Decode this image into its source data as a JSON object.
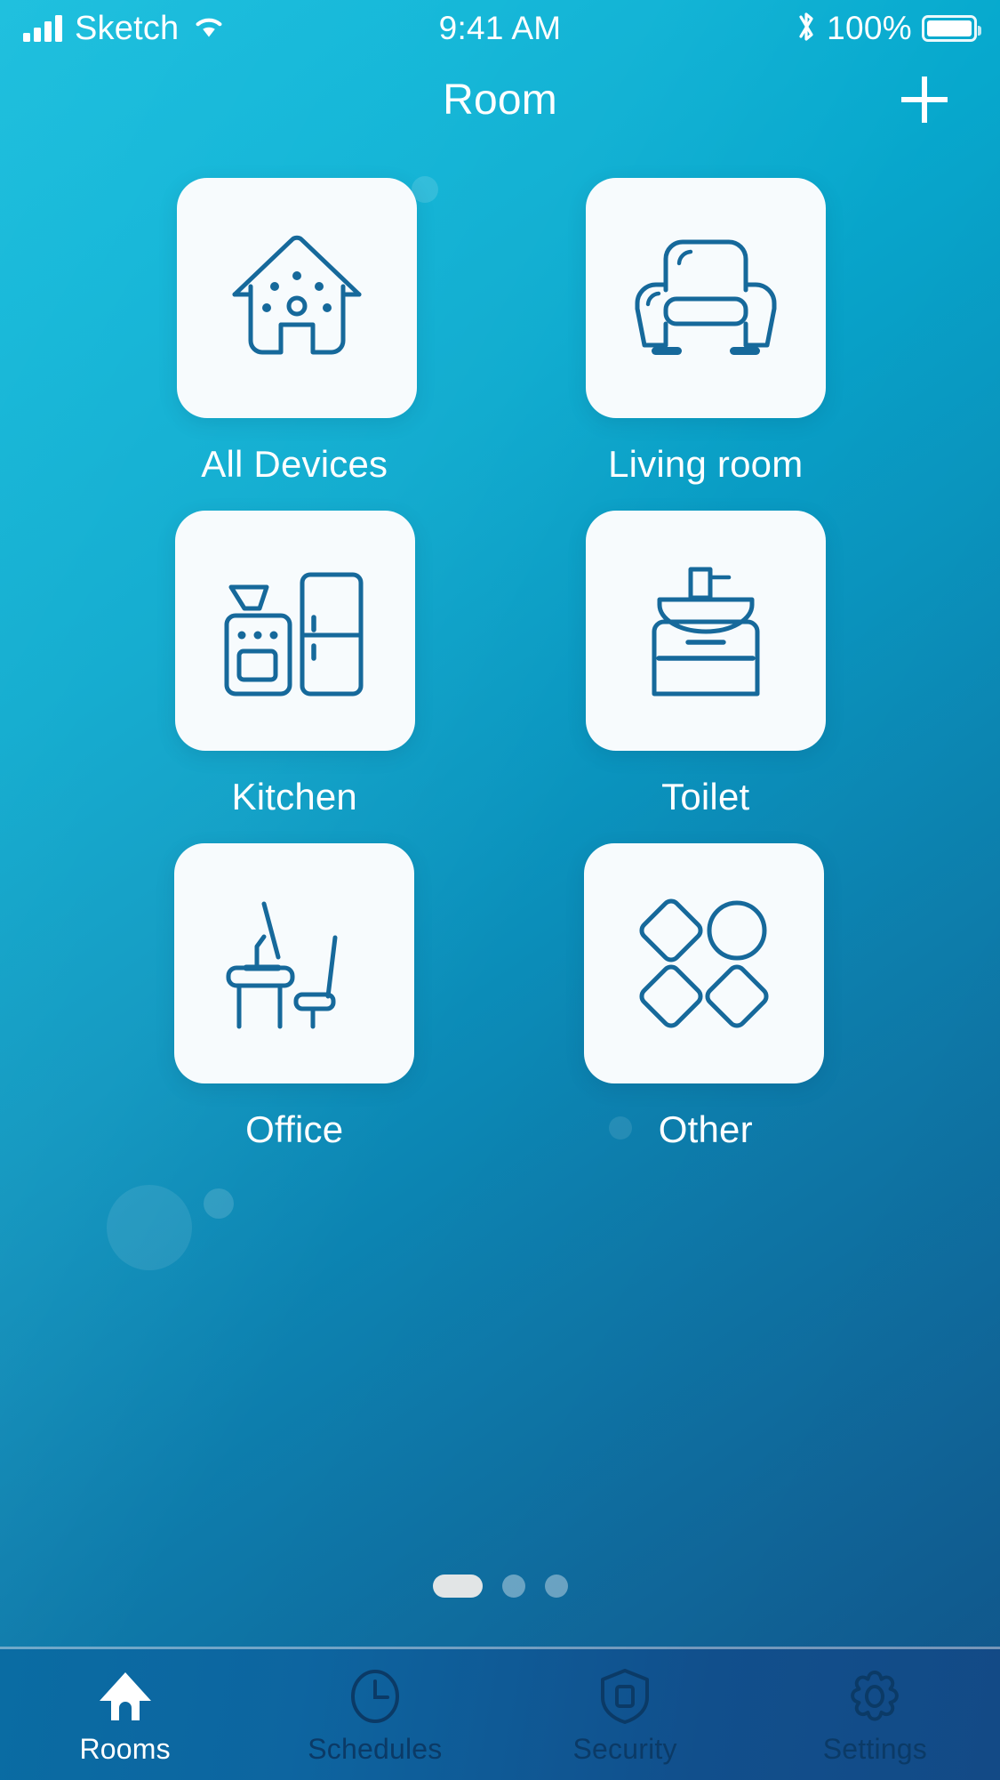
{
  "status_bar": {
    "carrier": "Sketch",
    "time": "9:41 AM",
    "battery_percent": "100%",
    "signal_icon": "signal-bars-icon",
    "wifi_icon": "wifi-icon",
    "bluetooth_icon": "bluetooth-icon",
    "battery_icon": "battery-full-icon"
  },
  "navbar": {
    "title": "Room",
    "add_label": "+",
    "add_icon": "plus-icon"
  },
  "rooms": [
    {
      "label": "All Devices",
      "icon": "house-devices-icon"
    },
    {
      "label": "Living room",
      "icon": "armchair-icon"
    },
    {
      "label": "Kitchen",
      "icon": "stove-fridge-icon"
    },
    {
      "label": "Toilet",
      "icon": "sink-cabinet-icon"
    },
    {
      "label": "Office",
      "icon": "desk-chair-lamp-icon"
    },
    {
      "label": "Other",
      "icon": "shapes-grid-icon"
    }
  ],
  "pagination": {
    "total": 3,
    "active_index": 0
  },
  "tabs": [
    {
      "label": "Rooms",
      "icon": "home-filled-icon",
      "active": true
    },
    {
      "label": "Schedules",
      "icon": "clock-icon",
      "active": false
    },
    {
      "label": "Security",
      "icon": "shield-icon",
      "active": false
    },
    {
      "label": "Settings",
      "icon": "gear-icon",
      "active": false
    }
  ],
  "colors": {
    "bg_top": "#0bbadb",
    "bg_bottom": "#12568d",
    "card_bg": "#f7fbfd",
    "icon_stroke": "#16699b",
    "tab_inactive": "#0b3a66",
    "tab_active": "#ffffff",
    "dot_active": "#e2e5e6"
  }
}
